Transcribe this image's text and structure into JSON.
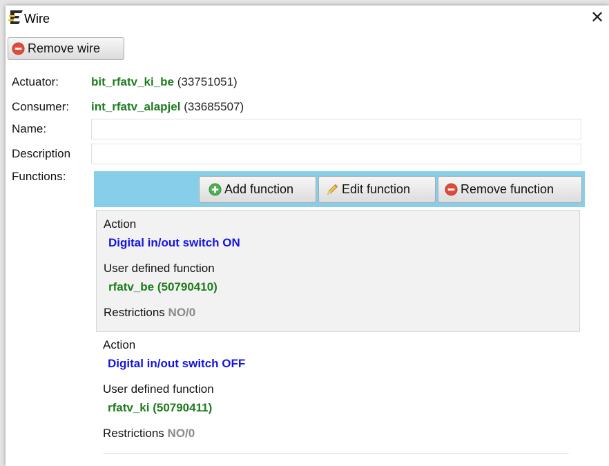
{
  "window": {
    "title": "Wire",
    "close_symbol": "✕"
  },
  "toolbar": {
    "remove_wire_label": "Remove wire"
  },
  "fields": {
    "actuator": {
      "label": "Actuator:",
      "name": "bit_rfatv_ki_be",
      "id": "(33751051)"
    },
    "consumer": {
      "label": "Consumer:",
      "name": "int_rfatv_alapjel",
      "id": "(33685507)"
    },
    "name": {
      "label": "Name:",
      "value": ""
    },
    "description": {
      "label": "Description",
      "value": ""
    },
    "functions_label": "Functions:"
  },
  "functions_toolbar": {
    "add_label": "Add function",
    "edit_label": "Edit function",
    "remove_label": "Remove function"
  },
  "functions": [
    {
      "action_label": "Action",
      "action_value": "Digital in/out switch ON",
      "udf_label": "User defined function",
      "udf_value": "rfatv_be (50790410)",
      "restrictions_label": "Restrictions",
      "restrictions_value": "NO/0"
    },
    {
      "action_label": "Action",
      "action_value": "Digital in/out switch OFF",
      "udf_label": "User defined function",
      "udf_value": "rfatv_ki (50790411)",
      "restrictions_label": "Restrictions",
      "restrictions_value": "NO/0"
    }
  ],
  "icons": {
    "app": "app-logo-icon",
    "remove": "minus-circle-icon",
    "add": "plus-circle-icon",
    "edit": "pencil-icon"
  },
  "colors": {
    "toolbar_bg": "#87ceeb",
    "green_value": "#1e7c1e",
    "blue_value": "#1414e6",
    "grey_value": "#8a8a8a",
    "remove_icon": "#e04b3a",
    "add_icon": "#4caf50"
  }
}
